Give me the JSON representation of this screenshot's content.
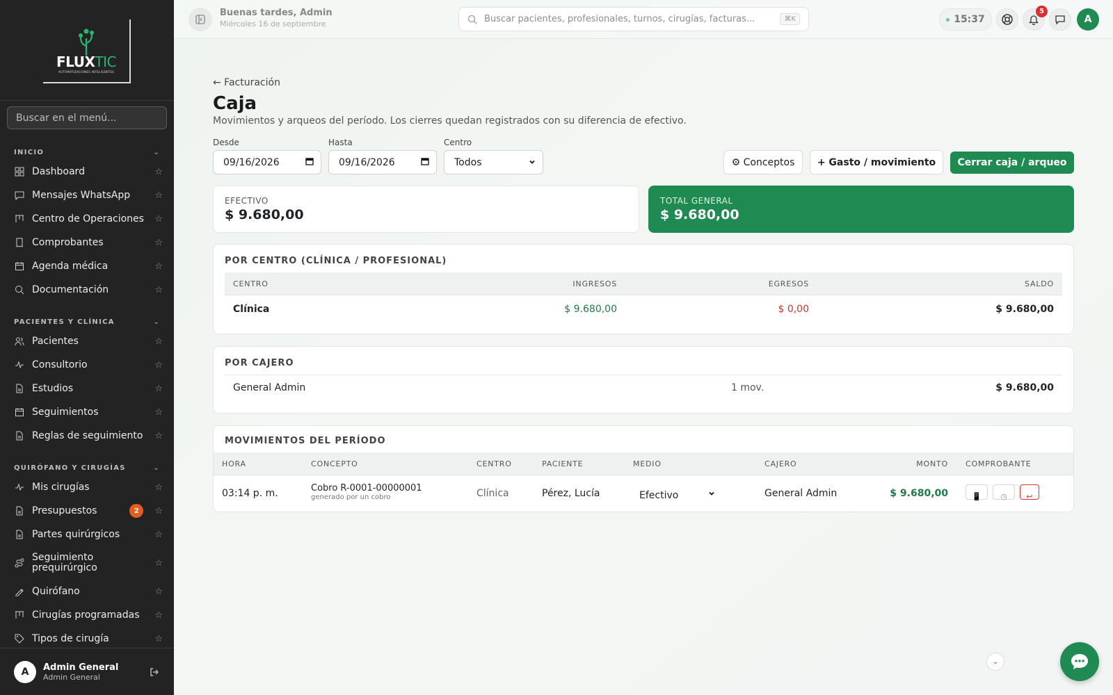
{
  "sidebar": {
    "logo": {
      "brand_a": "FLUX",
      "brand_b": "TIC",
      "tagline": "AUTOMATIZACIONES INTELIGENTES"
    },
    "search_placeholder": "Buscar en el menú...",
    "groups": [
      {
        "title": "INICIO",
        "items": [
          {
            "label": "Dashboard",
            "icon": "grid-icon"
          },
          {
            "label": "Mensajes WhatsApp",
            "icon": "message-icon"
          },
          {
            "label": "Centro de Operaciones",
            "icon": "kanban-icon"
          },
          {
            "label": "Comprobantes",
            "icon": "receipt-icon"
          },
          {
            "label": "Agenda médica",
            "icon": "calendar-icon"
          },
          {
            "label": "Documentación",
            "icon": "doc-search-icon"
          }
        ]
      },
      {
        "title": "PACIENTES Y CLÍNICA",
        "items": [
          {
            "label": "Pacientes",
            "icon": "users-icon"
          },
          {
            "label": "Consultorio",
            "icon": "activity-icon"
          },
          {
            "label": "Estudios",
            "icon": "file-icon"
          },
          {
            "label": "Seguimientos",
            "icon": "calendar-icon"
          },
          {
            "label": "Reglas de seguimiento",
            "icon": "file-icon"
          }
        ]
      },
      {
        "title": "QUIRÓFANO Y CIRUGÍAS",
        "items": [
          {
            "label": "Mis cirugías",
            "icon": "activity-icon"
          },
          {
            "label": "Presupuestos",
            "icon": "file-icon",
            "badge": "2"
          },
          {
            "label": "Partes quirúrgicos",
            "icon": "file-icon"
          },
          {
            "label": "Seguimiento prequirúrgico",
            "icon": "route-icon"
          },
          {
            "label": "Quirófano",
            "icon": "scalpel-icon"
          },
          {
            "label": "Cirugías programadas",
            "icon": "kanban-icon"
          },
          {
            "label": "Tipos de cirugía",
            "icon": "tag-icon"
          }
        ]
      }
    ],
    "user": {
      "initial": "A",
      "name": "Admin General",
      "role": "Admin General"
    }
  },
  "topbar": {
    "greeting": "Buenas tardes, Admin",
    "date": "Miércoles 16 de septiembre",
    "search_placeholder": "Buscar pacientes, profesionales, turnos, cirugías, facturas...",
    "search_shortcut": "⌘K",
    "time": "15:37",
    "notifications_count": "5",
    "avatar_initial": "A"
  },
  "page": {
    "back_link": "← Facturación",
    "title": "Caja",
    "subtitle": "Movimientos y arqueos del período. Los cierres quedan registrados con su diferencia de efectivo.",
    "filters": {
      "desde_label": "Desde",
      "desde_value": "09/16/2026",
      "hasta_label": "Hasta",
      "hasta_value": "09/16/2026",
      "centro_label": "Centro",
      "centro_value": "Todos"
    },
    "buttons": {
      "conceptos": "⚙ Conceptos",
      "gasto": "+ Gasto / movimiento",
      "cerrar": "Cerrar caja / arqueo"
    },
    "kpis": {
      "efectivo_label": "EFECTIVO",
      "efectivo_value": "$ 9.680,00",
      "total_label": "TOTAL GENERAL",
      "total_value": "$ 9.680,00"
    },
    "por_centro": {
      "title": "POR CENTRO (CLÍNICA / PROFESIONAL)",
      "headers": [
        "CENTRO",
        "INGRESOS",
        "EGRESOS",
        "SALDO"
      ],
      "row": {
        "centro": "Clínica",
        "ingresos": "$ 9.680,00",
        "egresos": "$ 0,00",
        "saldo": "$ 9.680,00"
      }
    },
    "por_cajero": {
      "title": "POR CAJERO",
      "row": {
        "cajero": "General Admin",
        "movs": "1 mov.",
        "total": "$ 9.680,00"
      }
    },
    "movimientos": {
      "title": "MOVIMIENTOS DEL PERÍODO",
      "headers": [
        "HORA",
        "CONCEPTO",
        "CENTRO",
        "PACIENTE",
        "MEDIO",
        "CAJERO",
        "MONTO",
        "COMPROBANTE"
      ],
      "row": {
        "hora": "03:14 p. m.",
        "concepto": "Cobro R-0001-00000001",
        "concepto_sub": "generado por un cobro",
        "centro": "Clínica",
        "paciente": "Pérez, Lucía",
        "medio": "Efectivo",
        "cajero": "General Admin",
        "monto": "$ 9.680,00"
      }
    }
  },
  "colors": {
    "brand_green": "#208a53",
    "sidebar_bg": "#232323",
    "badge_orange": "#e35d1f",
    "negative_red": "#c0392b"
  }
}
